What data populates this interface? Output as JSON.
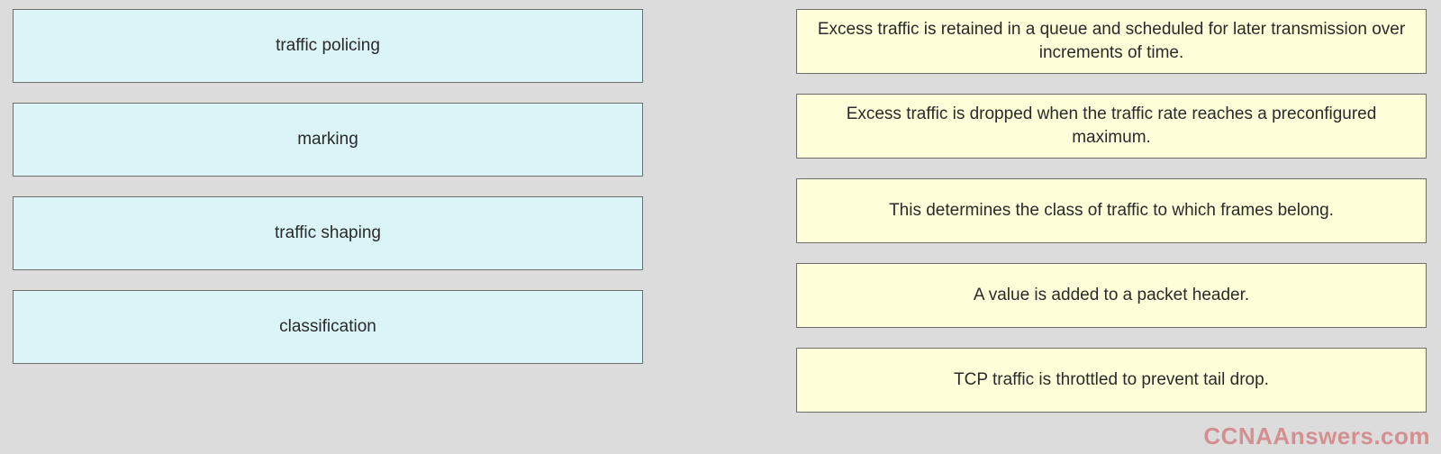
{
  "left_column": {
    "items": [
      {
        "label": "traffic policing"
      },
      {
        "label": "marking"
      },
      {
        "label": "traffic shaping"
      },
      {
        "label": "classification"
      }
    ]
  },
  "right_column": {
    "items": [
      {
        "label": "Excess traffic is retained in a queue and scheduled for later transmission over increments of time."
      },
      {
        "label": "Excess traffic is dropped when the traffic rate reaches a preconfigured maximum."
      },
      {
        "label": "This determines the class of traffic to which frames belong."
      },
      {
        "label": "A value is added to a packet header."
      },
      {
        "label": "TCP traffic is throttled to prevent tail drop."
      }
    ]
  },
  "watermark": "CCNAAnswers.com"
}
